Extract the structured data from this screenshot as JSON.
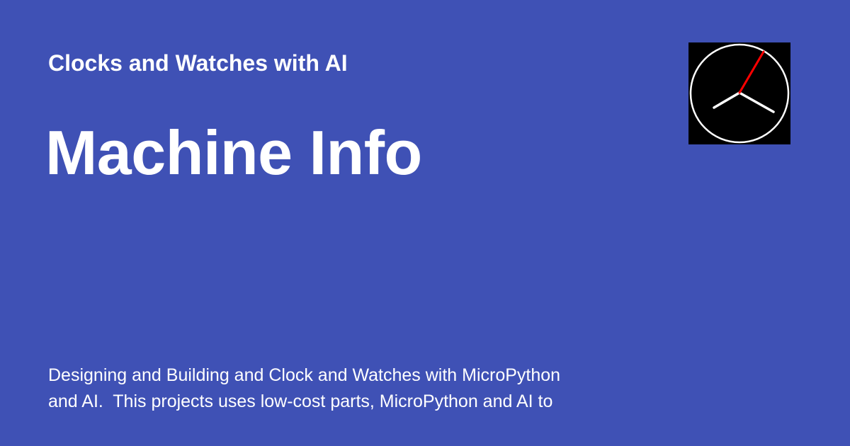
{
  "header": {
    "site_name": "Clocks and Watches with AI"
  },
  "main": {
    "title": "Machine Info",
    "description": "Designing and Building and Clock and Watches with MicroPython\nand AI.  This projects uses low-cost parts, MicroPython and AI to"
  },
  "logo": {
    "icon": "analog-clock-icon"
  },
  "colors": {
    "background": "#3f51b5",
    "text": "#ffffff",
    "logo_background": "#000000",
    "clock_face": "#ffffff",
    "second_hand": "#ff0000"
  }
}
